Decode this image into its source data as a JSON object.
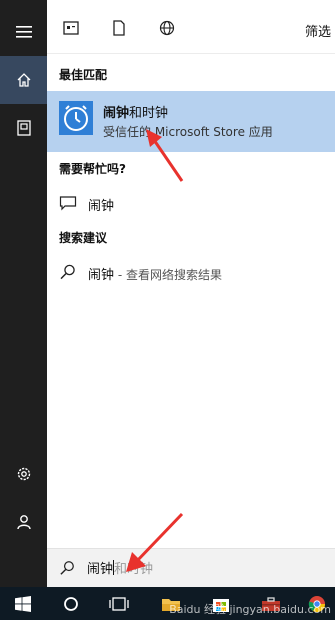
{
  "colors": {
    "rail_bg": "#1f1f1f",
    "rail_active": "#37485f",
    "highlight": "#b6d1ef",
    "taskbar_bg": "#0e1a24",
    "arrow_red": "#e8322d",
    "app_icon_blue": "#2f7fd6"
  },
  "rail": {
    "items": [
      {
        "icon": "hamburger-menu-icon"
      },
      {
        "icon": "home-icon"
      },
      {
        "icon": "notebook-icon"
      },
      {
        "icon": "settings-gear-icon"
      },
      {
        "icon": "feedback-user-icon"
      }
    ]
  },
  "topbar": {
    "icons": [
      "apps-filter-icon",
      "documents-filter-icon",
      "web-filter-icon"
    ],
    "filter_label": "筛选"
  },
  "best_match": {
    "heading": "最佳匹配",
    "app_name_bold": "闹钟",
    "app_name_rest": "和时钟",
    "app_subtitle": "受信任的 Microsoft Store 应用",
    "icon": "alarm-clock-app-icon"
  },
  "help": {
    "heading": "需要帮忙吗?",
    "item_label": "闹钟",
    "icon": "help-chat-icon"
  },
  "suggestions": {
    "heading": "搜索建议",
    "item_label": "闹钟",
    "item_suffix": " - 查看网络搜索结果",
    "icon": "search-icon"
  },
  "search": {
    "typed": "闹钟",
    "autocomplete": "和时钟"
  },
  "taskbar": {
    "items": [
      "windows-start-icon",
      "cortana-circle-icon",
      "task-view-icon",
      "file-explorer-icon",
      "store-icon",
      "toolbox-icon",
      "chrome-icon"
    ]
  },
  "watermark": "Baidu 经验  jingyan.baidu.com"
}
